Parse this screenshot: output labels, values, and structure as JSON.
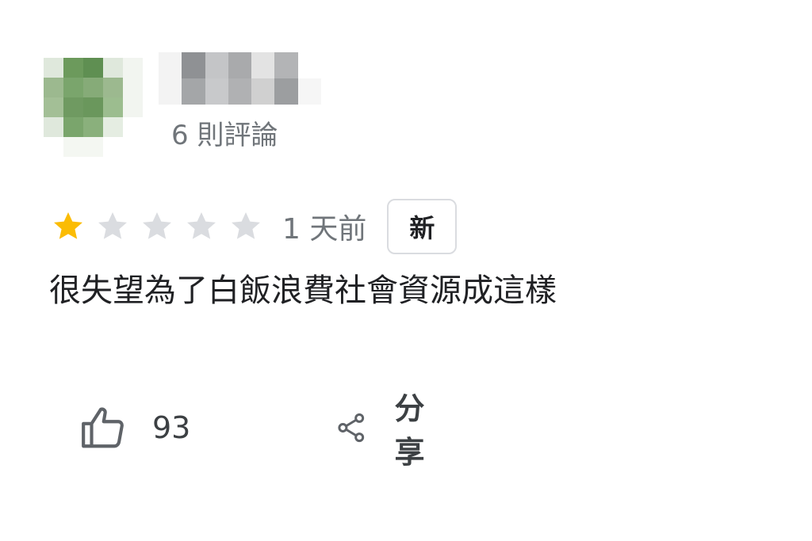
{
  "reviewer": {
    "avatar_colors": [
      "#dfe8dc",
      "#6c9a5c",
      "#5f8f52",
      "#dfe8dc",
      "#f2f5f0",
      "#9cb98f",
      "#7aa56c",
      "#86ab78",
      "#9cb98f",
      "#f2f5f0",
      "#a3bf96",
      "#6f9a61",
      "#6a975c",
      "#9cbd8f",
      "#f2f5f0",
      "#dfe8dc",
      "#7aa56c",
      "#8ab07c",
      "#e5ede2",
      "#ffffff",
      "#ffffff",
      "#f4f7f2",
      "#f4f7f2",
      "#ffffff",
      "#ffffff"
    ],
    "name_blur_colors": [
      "#f3f3f3",
      "#8f9194",
      "#c4c5c7",
      "#a9aaac",
      "#e3e3e3",
      "#b3b4b6",
      "#ffffff",
      "#f3f3f3",
      "#a4a6a8",
      "#c8c9cb",
      "#b0b1b3",
      "#d0d0d0",
      "#9c9ea0",
      "#f6f6f6"
    ],
    "review_count": "6 則評論"
  },
  "rating": {
    "value": 1,
    "max": 5,
    "filled_color": "#fbbc04",
    "empty_color": "#dadce0"
  },
  "time_ago": "1 天前",
  "badge": "新",
  "review_text": "很失望為了白飯浪費社會資源成這樣",
  "actions": {
    "like_icon": "thumbs-up-icon",
    "like_count": "93",
    "share_icon": "share-icon",
    "share_label": "分享"
  }
}
